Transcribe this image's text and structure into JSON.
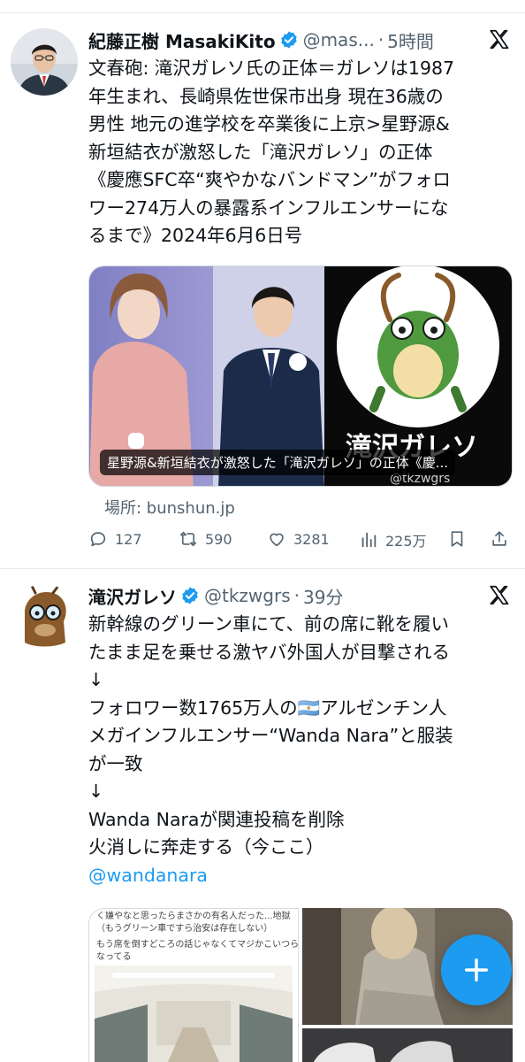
{
  "tweet1": {
    "display_name": "紀藤正樹 MasakiKito",
    "handle": "@mas...",
    "time": "5時間",
    "text_lines": [
      "文春砲: 滝沢ガレソ氏の正体＝ガレソは1987",
      "年生まれ、長崎県佐世保市出身 現在36歳の",
      "男性 地元の進学校を卒業後に上京>星野源&",
      "新垣結衣が激怒した「滝沢ガレソ」の正体",
      "《慶應SFC卒“爽やかなバンドマン”がフォロ",
      "ワー274万人の暴露系インフルエンサーにな",
      "るまで》2024年6月6日号"
    ],
    "media": {
      "caption": "星野源&新垣結衣が激怒した「滝沢ガレソ」の正体《慶...",
      "overlay_name": "滝沢ガレソ",
      "overlay_handle": "@tkzwgrs"
    },
    "card_source": "場所: bunshun.jp",
    "actions": {
      "replies": "127",
      "reposts": "590",
      "likes": "3281",
      "views": "225万"
    }
  },
  "tweet2": {
    "display_name": "滝沢ガレソ",
    "handle": "@tkzwgrs",
    "time": "39分",
    "text_lines": [
      "新幹線のグリーン車にて、前の席に靴を履い",
      "たまま足を乗せる激ヤバ外国人が目撃される",
      "↓",
      "フォロワー数1765万人の🇦🇷アルゼンチン人",
      "メガインフルエンサー“Wanda Nara”と服装",
      "が一致",
      "↓",
      "Wanda Naraが関連投稿を削除",
      "火消しに奔走する（今ここ）"
    ],
    "mention": "@wandanara",
    "media": {
      "screenshot_line1": "く嫌やなと思ったらまさかの有名人だった...地獄",
      "screenshot_line2": "（もうグリーン車ですら治安は存在しない）",
      "screenshot_line3": "もう席を倒すどころの話じゃなくてマジかこいつら...って",
      "screenshot_line4": "なってる"
    }
  },
  "colors": {
    "accent": "#1d9bf0",
    "text": "#0f1419",
    "secondary": "#536471",
    "verified": "#1d9bf0"
  }
}
